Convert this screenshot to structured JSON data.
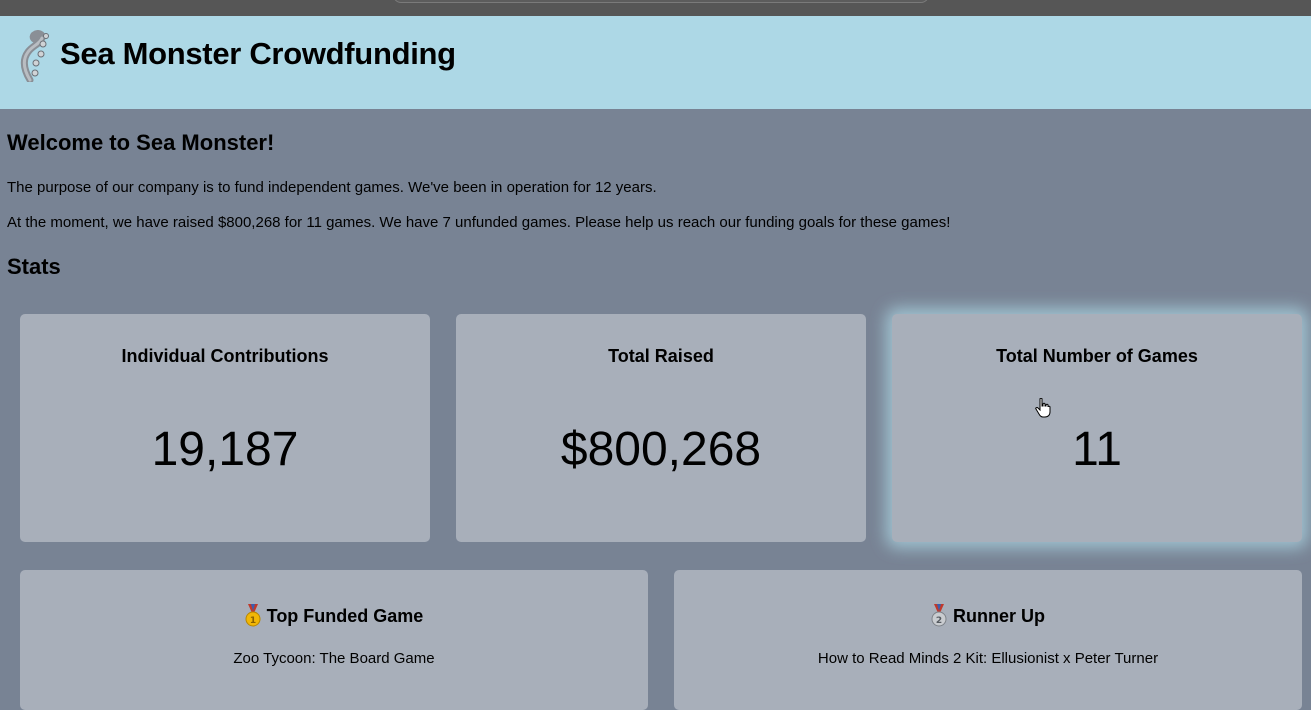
{
  "header": {
    "logo_icon": "sea-monster-tentacle-icon",
    "title": "Sea Monster Crowdfunding",
    "background": "#add8e6"
  },
  "intro": {
    "heading": "Welcome to Sea Monster!",
    "paragraph1": "The purpose of our company is to fund independent games. We've been in operation for 12 years.",
    "paragraph2": "At the moment, we have raised $800,268 for 11 games. We have 7 unfunded games. Please help us reach our funding goals for these games!"
  },
  "stats": {
    "heading": "Stats",
    "cards": [
      {
        "title": "Individual Contributions",
        "value": "19,187"
      },
      {
        "title": "Total Raised",
        "value": "$800,268"
      },
      {
        "title": "Total Number of Games",
        "value": "11"
      }
    ]
  },
  "top_games": [
    {
      "medal_icon": "gold-medal-icon",
      "heading": "Top Funded Game",
      "game": "Zoo Tycoon: The Board Game"
    },
    {
      "medal_icon": "silver-medal-icon",
      "heading": "Runner Up",
      "game": "How to Read Minds 2 Kit: Ellusionist x Peter Turner"
    }
  ],
  "colors": {
    "page_background": "#788394",
    "card_background": "#a8afba",
    "hover_glow": "#add8e6"
  }
}
